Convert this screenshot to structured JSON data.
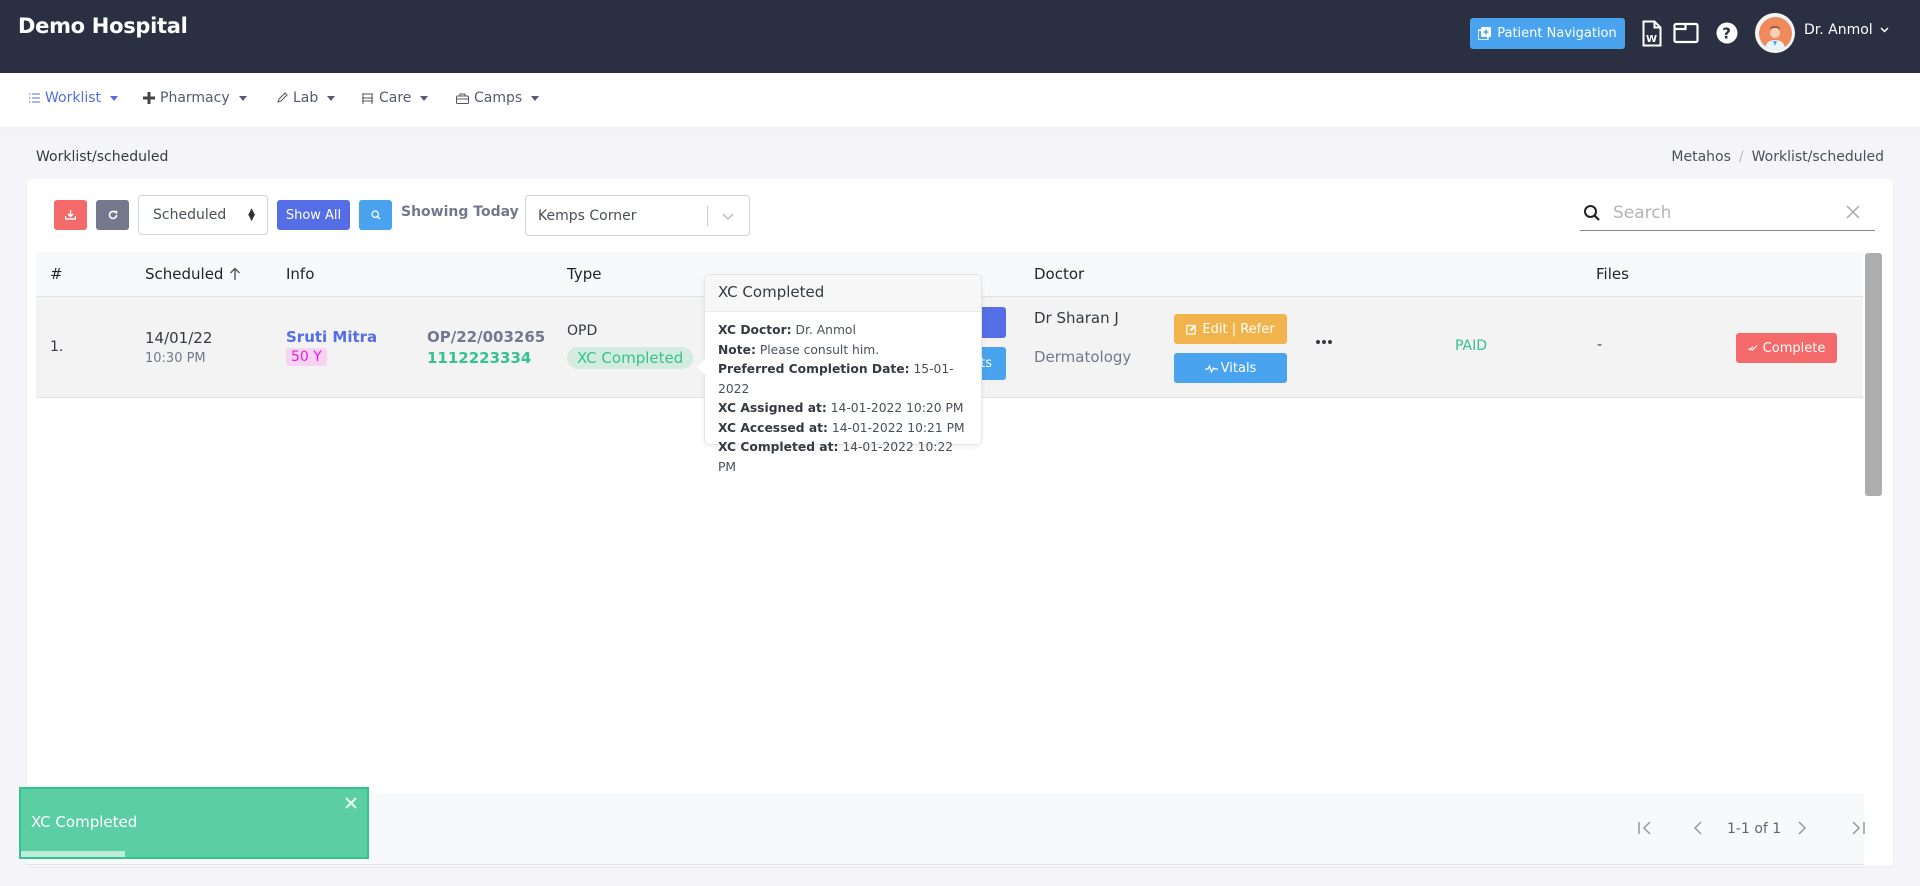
{
  "app": {
    "brand": "Demo Hospital",
    "patient_nav_label": "Patient Navigation",
    "user_name": "Dr. Anmol",
    "icons": [
      "word-doc-icon",
      "window-icon",
      "help-icon"
    ]
  },
  "nav": {
    "items": [
      {
        "label": "Worklist",
        "icon": "list-icon",
        "active": true
      },
      {
        "label": "Pharmacy",
        "icon": "plus-icon",
        "active": false
      },
      {
        "label": "Lab",
        "icon": "pencil-icon",
        "active": false
      },
      {
        "label": "Care",
        "icon": "bed-icon",
        "active": false
      },
      {
        "label": "Camps",
        "icon": "briefcase-icon",
        "active": false
      }
    ]
  },
  "page": {
    "title": "Worklist/scheduled",
    "breadcrumb": [
      "Metahos",
      "Worklist/scheduled"
    ]
  },
  "toolbar": {
    "status_select": "Scheduled",
    "show_all_label": "Show All",
    "showing_label": "Showing Today",
    "location_select": "Kemps Corner",
    "search_placeholder": "Search",
    "search_value": ""
  },
  "table": {
    "headers": {
      "num": "#",
      "scheduled": "Scheduled",
      "info": "Info",
      "type": "Type",
      "doctor": "Doctor",
      "files": "Files"
    },
    "rows": [
      {
        "num": "1.",
        "date": "14/01/22",
        "time": "10:30 PM",
        "patient_name": "Sruti Mitra",
        "age": "50 Y",
        "op_number": "OP/22/003265",
        "phone": "1112223334",
        "type": "OPD",
        "type_status": "XC Completed",
        "hidden_button_fragment": "ts",
        "doctor": "Dr Sharan J",
        "department": "Dermatology",
        "edit_label": "Edit | Refer",
        "vitals_label": "Vitals",
        "payment_status": "PAID",
        "files": "-",
        "complete_label": "Complete"
      }
    ]
  },
  "popover": {
    "title": "XC Completed",
    "lines": [
      {
        "label": "XC Doctor:",
        "value": "Dr. Anmol"
      },
      {
        "label": "Note:",
        "value": "Please consult him."
      },
      {
        "label": "Preferred Completion Date:",
        "value": "15-01-2022"
      },
      {
        "label": "XC Assigned at:",
        "value": "14-01-2022 10:20 PM"
      },
      {
        "label": "XC Accessed at:",
        "value": "14-01-2022 10:21 PM"
      },
      {
        "label": "XC Completed at:",
        "value": "14-01-2022 10:22 PM"
      }
    ]
  },
  "pagination": {
    "label": "1-1 of 1"
  },
  "toast": {
    "message": "XC Completed",
    "progress_percent": 30
  },
  "colors": {
    "topbar": "#2a3042",
    "primary": "#556ee6",
    "info": "#4aa3ee",
    "success": "#34c38f",
    "warning": "#f1b44c",
    "danger": "#f46a6a",
    "secondary": "#74788d"
  }
}
